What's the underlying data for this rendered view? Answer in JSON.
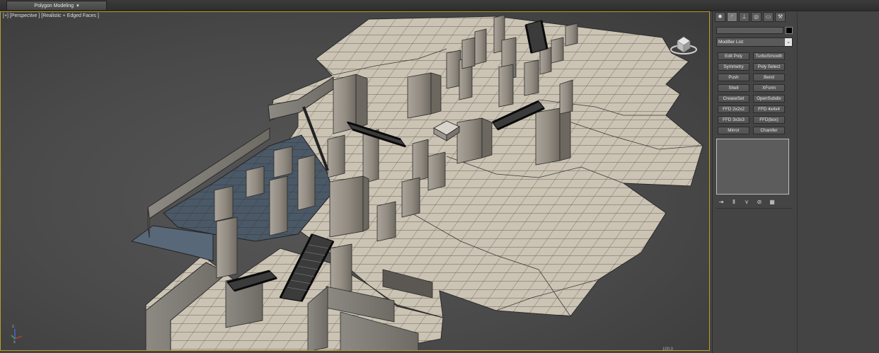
{
  "ribbon": {
    "tab_label": "Polygon Modeling",
    "tab_arrow_icon": "dropdown-arrow-icon"
  },
  "viewport": {
    "label": "[+] [Perspective ] [Realistic + Edged Faces ]",
    "status_value": "100.0"
  },
  "command_panel": {
    "tabs": [
      {
        "icon": "create-icon",
        "glyph": "✹"
      },
      {
        "icon": "modify-icon",
        "glyph": "◜"
      },
      {
        "icon": "hierarchy-icon",
        "glyph": "⊥"
      },
      {
        "icon": "motion-icon",
        "glyph": "◎"
      },
      {
        "icon": "display-icon",
        "glyph": "▭"
      },
      {
        "icon": "utilities-icon",
        "glyph": "⚒"
      }
    ],
    "modifier_list_label": "Modifier List",
    "modifier_buttons": [
      [
        "Edit Poly",
        "TurboSmooth"
      ],
      [
        "Symmetry",
        "Poly Select"
      ],
      [
        "Push",
        "Bend"
      ],
      [
        "Shell",
        "XForm"
      ],
      [
        "CreaseSet",
        "OpenSubdiv"
      ],
      [
        "FFD 2x2x2",
        "FFD 4x4x4"
      ],
      [
        "FFD 3x3x3",
        "FFD(box)"
      ],
      [
        "Mirror",
        "Chamfer"
      ]
    ],
    "stack_icons": [
      {
        "icon": "pin-stack-icon",
        "glyph": "⇥"
      },
      {
        "icon": "show-end-result-icon",
        "glyph": "Ⅱ"
      },
      {
        "icon": "make-unique-icon",
        "glyph": "⋎"
      },
      {
        "icon": "remove-modifier-icon",
        "glyph": "⊘"
      },
      {
        "icon": "configure-modifier-sets-icon",
        "glyph": "▦"
      }
    ]
  }
}
